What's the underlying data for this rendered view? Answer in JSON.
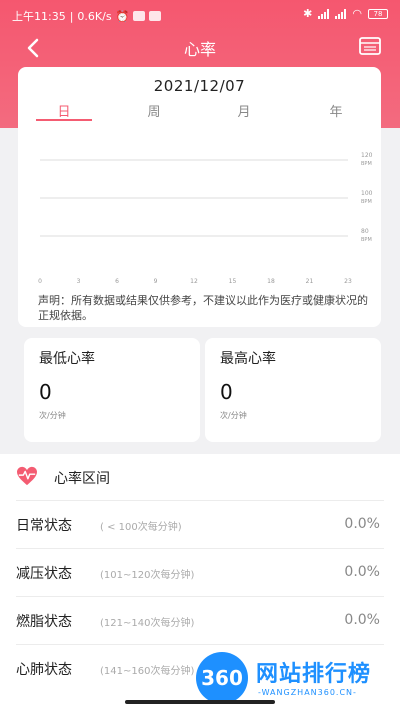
{
  "status_bar": {
    "time": "上午11:35",
    "speed": "0.6K/s",
    "battery": "78"
  },
  "nav": {
    "title": "心率",
    "back_icon": "chevron-left-icon",
    "right_icon": "calendar-icon"
  },
  "chart_card": {
    "date": "2021/12/07",
    "tabs": [
      "日",
      "周",
      "月",
      "年"
    ],
    "active_tab": "日",
    "disclaimer": "声明：所有数据或结果仅供参考，不建议以此作为医疗或健康状况的正规依据。"
  },
  "chart_data": {
    "type": "line",
    "x_ticks": [
      "0",
      "3",
      "6",
      "9",
      "12",
      "15",
      "18",
      "21",
      "23"
    ],
    "y_ticks": [
      {
        "value": "120",
        "unit": "BPM"
      },
      {
        "value": "100",
        "unit": "BPM"
      },
      {
        "value": "80",
        "unit": "BPM"
      }
    ],
    "series": [],
    "grid": true
  },
  "stats": {
    "min": {
      "title": "最低心率",
      "value": "0",
      "unit": "次/分钟"
    },
    "max": {
      "title": "最高心率",
      "value": "0",
      "unit": "次/分钟"
    }
  },
  "zones": {
    "title": "心率区间",
    "icon": "heart-icon",
    "rows": [
      {
        "name": "日常状态",
        "range": "( < 100次每分钟)",
        "pct": "0.0%"
      },
      {
        "name": "减压状态",
        "range": "(101~120次每分钟)",
        "pct": "0.0%"
      },
      {
        "name": "燃脂状态",
        "range": "(121~140次每分钟)",
        "pct": "0.0%"
      },
      {
        "name": "心肺状态",
        "range": "(141~160次每分钟)",
        "pct": ""
      }
    ]
  },
  "watermark": {
    "logo": "360",
    "text": "网站排行榜",
    "subtext": "-WANGZHAN360.CN-"
  },
  "colors": {
    "accent": "#f45c72",
    "header": "#f5576f",
    "watermark": "#1e90ff"
  }
}
